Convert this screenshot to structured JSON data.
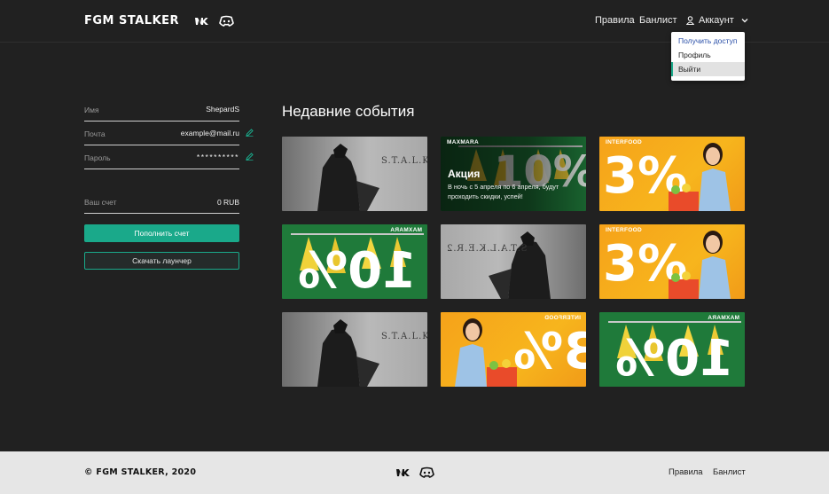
{
  "header": {
    "logo": "FGM STALKER",
    "nav": {
      "rules": "Правила",
      "banlist": "Банлист"
    },
    "account_label": "Аккаунт",
    "dropdown": [
      "Получить доступ",
      "Профиль",
      "Выйти"
    ]
  },
  "profile": {
    "name_label": "Имя",
    "name_value": "ShepardS",
    "email_label": "Почта",
    "email_value": "example@mail.ru",
    "password_label": "Пароль",
    "password_value": "**********",
    "balance_label": "Ваш счет",
    "balance_value": "0 RUB",
    "topup_button": "Пополнить счет",
    "download_button": "Скачать лаунчер"
  },
  "events": {
    "title": "Недавние события",
    "stalker_logo": "S.T.A.L.K.E.R.2",
    "maxmara_brand": "MAXMARA",
    "interfood_brand": "INTERFOOD",
    "pct_3": "3%",
    "pct_10": "10%",
    "promo_title": "Акция",
    "promo_text": "В ночь с 5 апреля по 6 апреля, будут проходить скидки, успей!"
  },
  "footer": {
    "copyright": "© FGM STALKER, 2020",
    "rules": "Правила",
    "banlist": "Банлист"
  },
  "colors": {
    "accent": "#1aa98a",
    "background": "#212121",
    "footer": "#e6e6e6"
  }
}
